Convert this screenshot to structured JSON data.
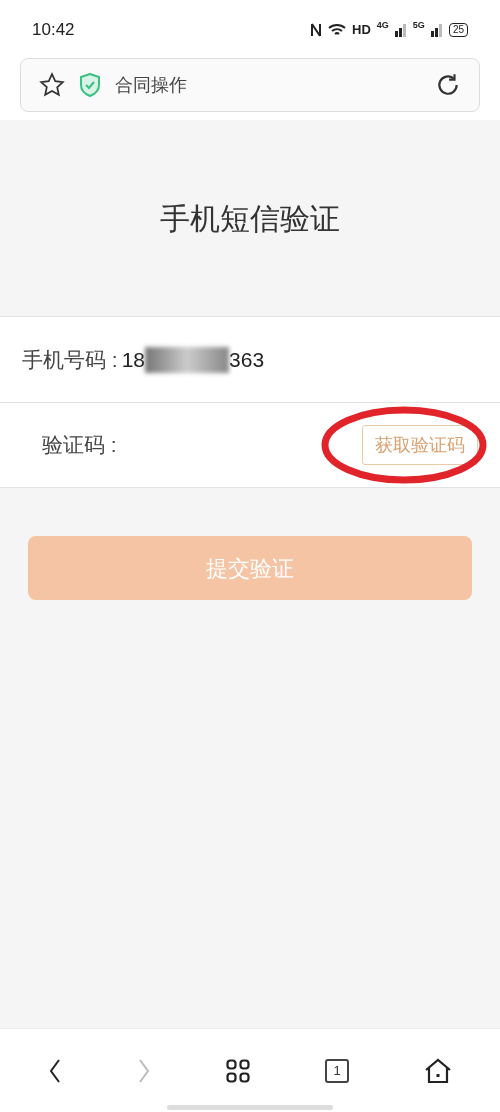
{
  "status_bar": {
    "time": "10:42",
    "hd": "HD",
    "net1": "4G",
    "net2": "5G",
    "battery": "25"
  },
  "address_bar": {
    "title": "合同操作",
    "bookmarked": false
  },
  "page_title": "手机短信验证",
  "phone": {
    "label": "手机号码 :",
    "value_start": "18",
    "value_end": "363",
    "redacted": true
  },
  "code": {
    "label": "验证码 :",
    "button": "获取验证码",
    "circled": true
  },
  "submit": {
    "label": "提交验证",
    "disabled": true
  },
  "bottom_nav": {
    "back_disabled": false,
    "forward_disabled": true,
    "tab_count": "1"
  }
}
